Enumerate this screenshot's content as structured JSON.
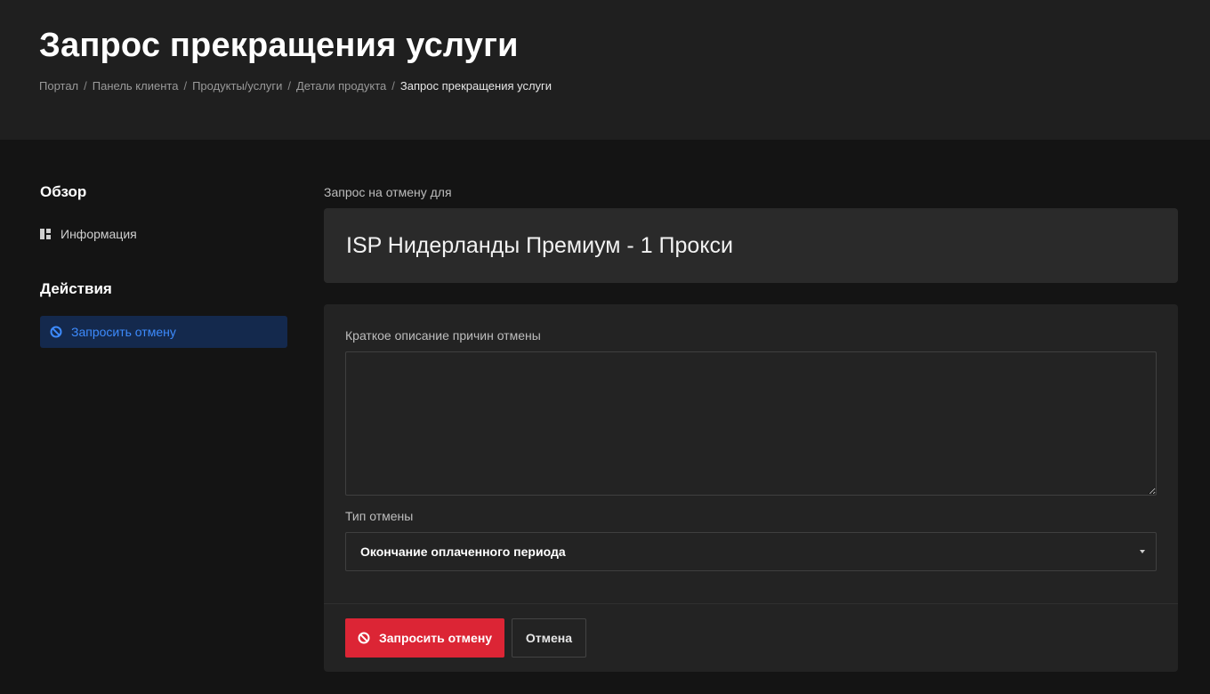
{
  "header": {
    "title": "Запрос прекращения услуги",
    "breadcrumb": [
      "Портал",
      "Панель клиента",
      "Продукты/услуги",
      "Детали продукта",
      "Запрос прекращения услуги"
    ],
    "separator": "/"
  },
  "sidebar": {
    "overview_heading": "Обзор",
    "overview_link": {
      "label": "Информация",
      "icon": "dashboard-icon"
    },
    "actions_heading": "Действия",
    "actions_link": {
      "label": "Запросить отмену",
      "icon": "ban-icon"
    }
  },
  "main": {
    "label": "Запрос на отмену для",
    "product_name": "ISP Нидерланды Премиум - 1 Прокси",
    "reason_label": "Краткое описание причин отмены",
    "reason_value": "",
    "type_label": "Тип отмены",
    "type_selected": "Окончание оплаченного периода",
    "submit_label": "Запросить отмену",
    "cancel_label": "Отмена"
  },
  "colors": {
    "accent_blue": "#3d8bfd",
    "danger_red": "#dc2535",
    "header_bg": "#1f1f1f",
    "page_bg": "#141414"
  }
}
